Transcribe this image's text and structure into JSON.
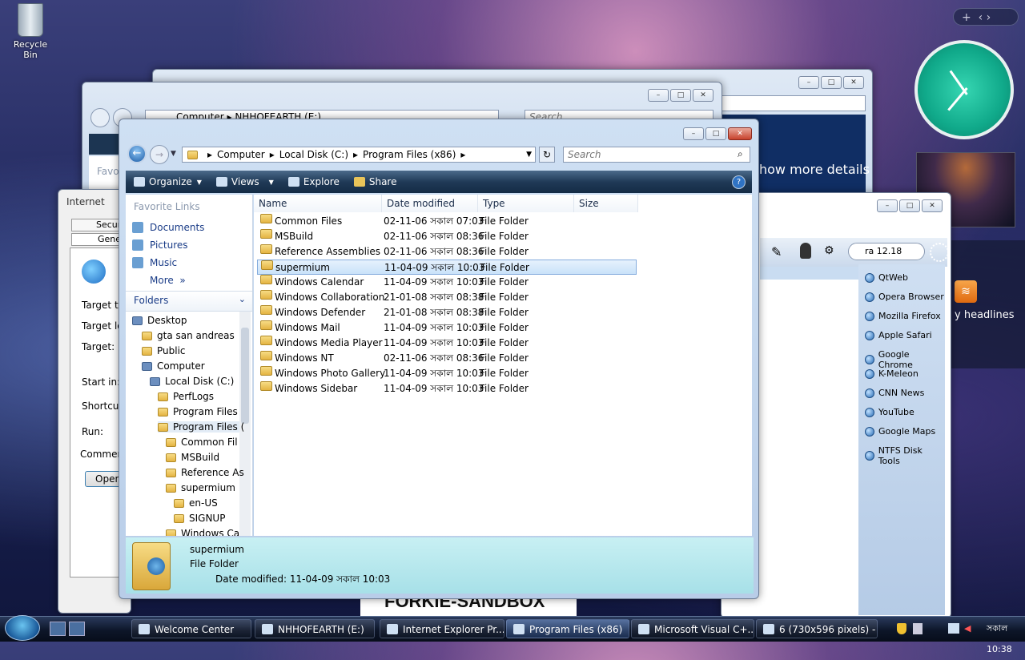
{
  "desktop": {
    "recycle_bin": "Recycle Bin"
  },
  "back_windows": {
    "explorer2_crumbs": [
      "Computer",
      "NHHOFEARTH (E:)"
    ],
    "explorer2_search": "Search",
    "explorer2_label": "Favo",
    "ie_props_title": "Internet",
    "ie_props_tabs": [
      "Secur",
      "Gene"
    ],
    "ie_props_fields": [
      "Target typ",
      "Target loc",
      "Target:",
      "Start in:",
      "Shortcut k",
      "Run:",
      "Comment:"
    ],
    "ie_props_open": "Open",
    "showmore": "how more details",
    "forkie": "FORKIE-SANDBOX",
    "rss_text": "y headlines",
    "browser_search": "ra 12.18",
    "bookmarks": [
      "QtWeb",
      "Opera Browser",
      "Mozilla Firefox",
      "Apple Safari",
      "Google Chrome",
      "K-Meleon",
      "CNN News",
      "YouTube",
      "Google Maps",
      "NTFS Disk Tools"
    ]
  },
  "explorer": {
    "address": [
      "Computer",
      "Local Disk (C:)",
      "Program Files (x86)"
    ],
    "search_placeholder": "Search",
    "toolbar": {
      "organize": "Organize",
      "views": "Views",
      "explore": "Explore",
      "share": "Share"
    },
    "favorite_links_title": "Favorite Links",
    "favorite_links": [
      "Documents",
      "Pictures",
      "Music"
    ],
    "more": "More",
    "folders_title": "Folders",
    "tree": [
      "Desktop",
      "gta san andreas",
      "Public",
      "Computer",
      "Local Disk (C:)",
      "PerfLogs",
      "Program Files",
      "Program Files (",
      "Common Fil",
      "MSBuild",
      "Reference As",
      "supermium",
      "en-US",
      "SIGNUP",
      "Windows Ca"
    ],
    "columns": [
      "Name",
      "Date modified",
      "Type",
      "Size"
    ],
    "files": [
      {
        "name": "Common Files",
        "date": "02-11-06 সকাল 07:03",
        "type": "File Folder"
      },
      {
        "name": "MSBuild",
        "date": "02-11-06 সকাল 08:36",
        "type": "File Folder"
      },
      {
        "name": "Reference Assemblies",
        "date": "02-11-06 সকাল 08:36",
        "type": "File Folder"
      },
      {
        "name": "supermium",
        "date": "11-04-09 সকাল 10:03",
        "type": "File Folder"
      },
      {
        "name": "Windows Calendar",
        "date": "11-04-09 সকাল 10:03",
        "type": "File Folder"
      },
      {
        "name": "Windows Collaboration",
        "date": "21-01-08 সকাল 08:38",
        "type": "File Folder"
      },
      {
        "name": "Windows Defender",
        "date": "21-01-08 সকাল 08:38",
        "type": "File Folder"
      },
      {
        "name": "Windows Mail",
        "date": "11-04-09 সকাল 10:03",
        "type": "File Folder"
      },
      {
        "name": "Windows Media Player",
        "date": "11-04-09 সকাল 10:03",
        "type": "File Folder"
      },
      {
        "name": "Windows NT",
        "date": "02-11-06 সকাল 08:36",
        "type": "File Folder"
      },
      {
        "name": "Windows Photo Gallery",
        "date": "11-04-09 সকাল 10:03",
        "type": "File Folder"
      },
      {
        "name": "Windows Sidebar",
        "date": "11-04-09 সকাল 10:03",
        "type": "File Folder"
      }
    ],
    "details": {
      "name": "supermium",
      "type": "File Folder",
      "date_label": "Date modified: 11-04-09 সকাল 10:03"
    }
  },
  "taskbar": {
    "tasks": [
      "Welcome Center",
      "NHHOFEARTH (E:)",
      "Internet Explorer Pr...",
      "Program Files (x86)",
      "Microsoft Visual C+...",
      "6 (730x596 pixels) - ..."
    ],
    "clock": "সকাল 10:38"
  }
}
